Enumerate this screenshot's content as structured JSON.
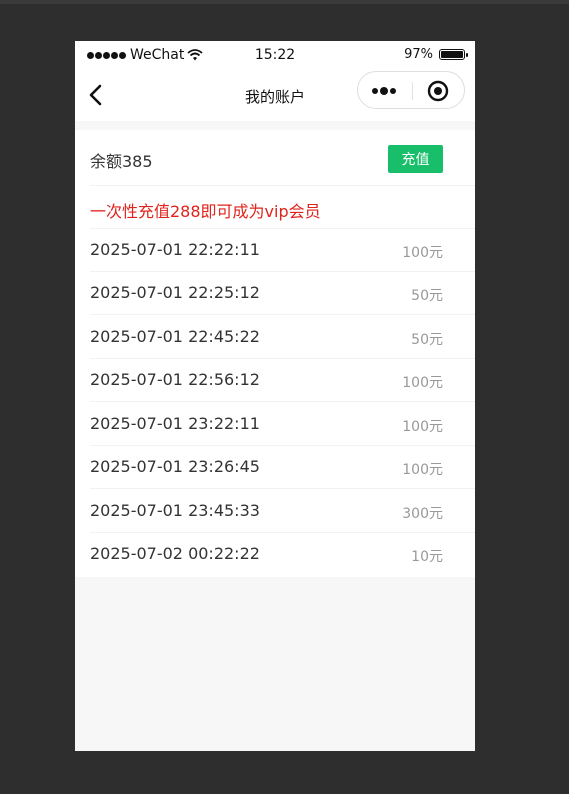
{
  "status_bar": {
    "carrier": "WeChat",
    "time": "15:22",
    "battery": "97%"
  },
  "navbar": {
    "title": "我的账户",
    "back_icon": "back-arrow-icon",
    "more_icon": "more-dots-icon",
    "close_icon": "close-target-icon"
  },
  "account": {
    "balance_text": "余额385",
    "recharge_label": "充值",
    "promo_text": "一次性充值288即可成为vip会员",
    "accent_color": "#19be6b",
    "promo_color": "#e0231c"
  },
  "records": [
    {
      "time": "2025-07-01 22:22:11",
      "amount": "100元"
    },
    {
      "time": "2025-07-01 22:25:12",
      "amount": "50元"
    },
    {
      "time": "2025-07-01 22:45:22",
      "amount": "50元"
    },
    {
      "time": "2025-07-01 22:56:12",
      "amount": "100元"
    },
    {
      "time": "2025-07-01 23:22:11",
      "amount": "100元"
    },
    {
      "time": "2025-07-01 23:26:45",
      "amount": "100元"
    },
    {
      "time": "2025-07-01 23:45:33",
      "amount": "300元"
    },
    {
      "time": "2025-07-02 00:22:22",
      "amount": "10元"
    }
  ]
}
